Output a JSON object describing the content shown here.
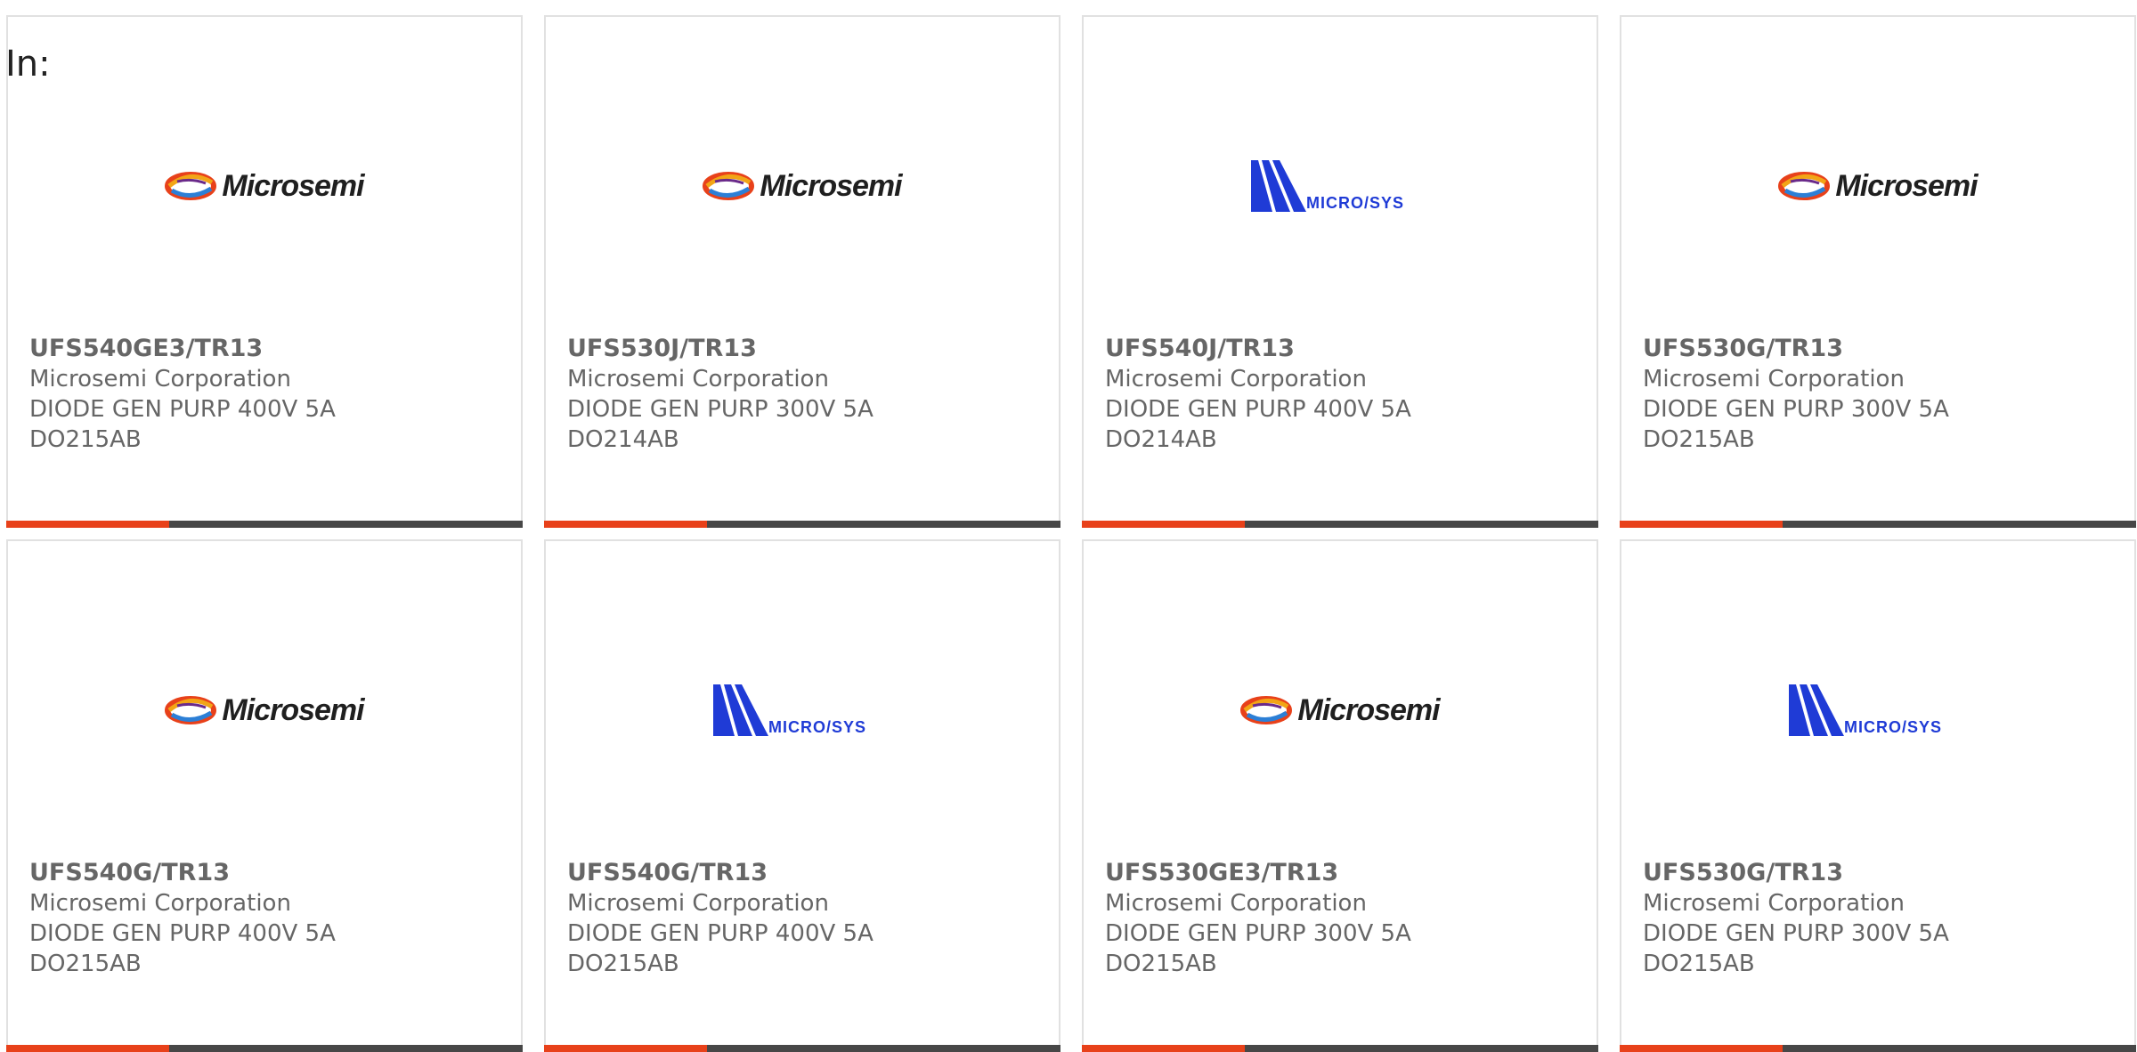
{
  "prefix_label": "In:",
  "colors": {
    "accent": "#e8411a",
    "bar": "#474747",
    "text": "#666666",
    "card_border": "#e1e1e1",
    "microsys_blue": "#1f3bd6"
  },
  "products": [
    {
      "part_number": "UFS540GE3/TR13",
      "manufacturer": "Microsemi Corporation",
      "description": "DIODE GEN PURP 400V 5A",
      "package": "DO215AB",
      "logo": "microsemi-logo"
    },
    {
      "part_number": "UFS530J/TR13",
      "manufacturer": "Microsemi Corporation",
      "description": "DIODE GEN PURP 300V 5A",
      "package": "DO214AB",
      "logo": "microsemi-logo"
    },
    {
      "part_number": "UFS540J/TR13",
      "manufacturer": "Microsemi Corporation",
      "description": "DIODE GEN PURP 400V 5A",
      "package": "DO214AB",
      "logo": "microsys-logo",
      "logo_text": "MICRO/SYS"
    },
    {
      "part_number": "UFS530G/TR13",
      "manufacturer": "Microsemi Corporation",
      "description": "DIODE GEN PURP 300V 5A",
      "package": "DO215AB",
      "logo": "microsemi-logo"
    },
    {
      "part_number": "UFS540G/TR13",
      "manufacturer": "Microsemi Corporation",
      "description": "DIODE GEN PURP 400V 5A",
      "package": "DO215AB",
      "logo": "microsemi-logo"
    },
    {
      "part_number": "UFS540G/TR13",
      "manufacturer": "Microsemi Corporation",
      "description": "DIODE GEN PURP 400V 5A",
      "package": "DO215AB",
      "logo": "microsys-logo",
      "logo_text": "MICRO/SYS"
    },
    {
      "part_number": "UFS530GE3/TR13",
      "manufacturer": "Microsemi Corporation",
      "description": "DIODE GEN PURP 300V 5A",
      "package": "DO215AB",
      "logo": "microsemi-logo"
    },
    {
      "part_number": "UFS530G/TR13",
      "manufacturer": "Microsemi Corporation",
      "description": "DIODE GEN PURP 300V 5A",
      "package": "DO215AB",
      "logo": "microsys-logo",
      "logo_text": "MICRO/SYS"
    }
  ],
  "microsemi_wordmark": "Microsemi"
}
